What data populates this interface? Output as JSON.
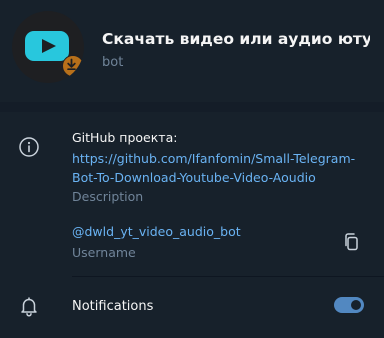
{
  "header": {
    "title": "Скачать видео или аудио юту...",
    "subtitle": "bot"
  },
  "info": {
    "github_label": "GitHub проекта:",
    "github_url": "https://github.com/Ifanfomin/Small-Telegram-Bot-To-Download-Youtube-Video-Aoudio",
    "description_label": "Description",
    "username": "@dwld_yt_video_audio_bot",
    "username_label": "Username"
  },
  "notifications": {
    "label": "Notifications",
    "enabled": true
  },
  "colors": {
    "background": "#17212b",
    "accent": "#5288c1",
    "link": "#6ab3f3",
    "muted": "#708499",
    "avatar_tile": "#28c7dd",
    "avatar_badge": "#b8701a"
  },
  "icons": {
    "info": "info-icon",
    "copy": "copy-icon",
    "bell": "bell-icon"
  }
}
